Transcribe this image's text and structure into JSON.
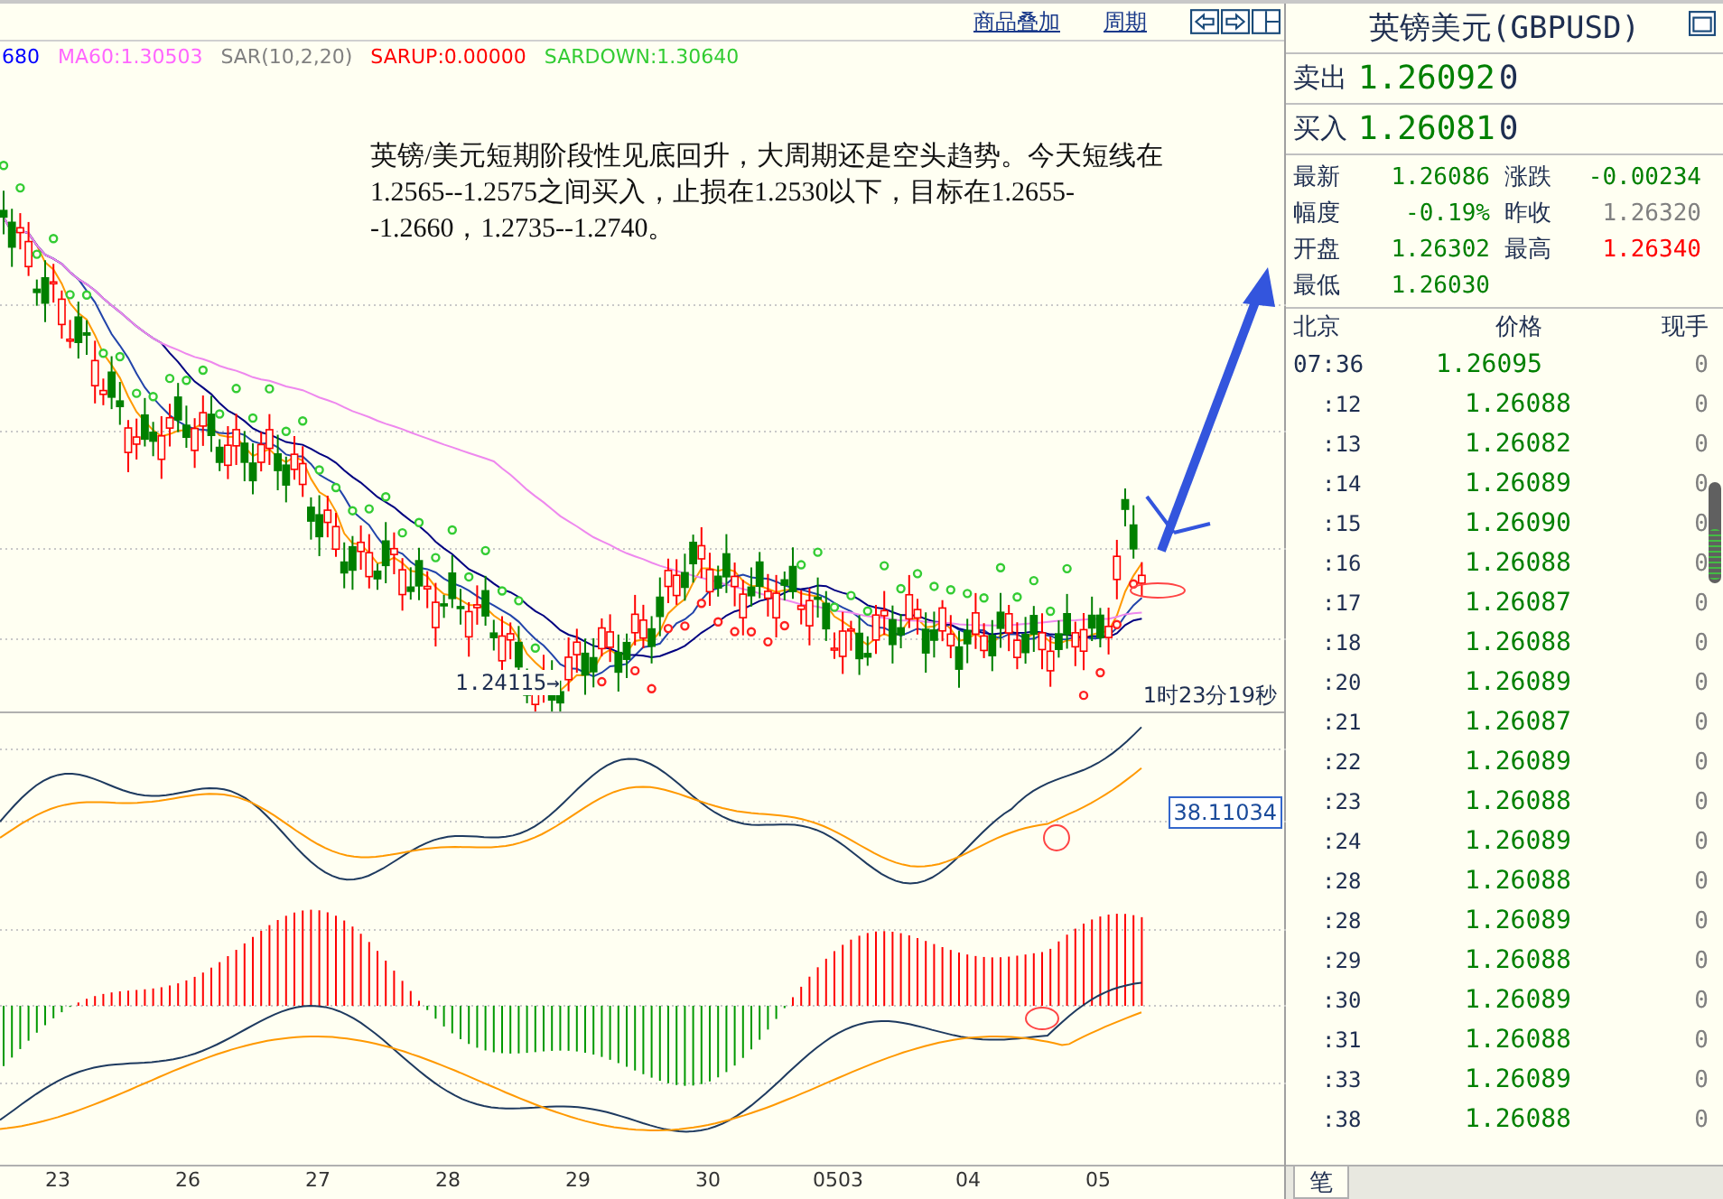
{
  "toolbar": {
    "links": [
      "商品叠加",
      "周期"
    ]
  },
  "legend": [
    {
      "text": "680",
      "color": "#0000ff"
    },
    {
      "text": "MA60:1.30503",
      "color": "#ff66ff"
    },
    {
      "text": "SAR(10,2,20)",
      "color": "#808080"
    },
    {
      "text": "SARUP:0.00000",
      "color": "#ff0000"
    },
    {
      "text": "SARDOWN:1.30640",
      "color": "#33cc33"
    }
  ],
  "annotation": "英镑/美元短期阶段性见底回升，大周期还是空头趋势。今天短线在1.2565--1.2575之间买入，止损在1.2530以下，目标在1.2655--1.2660，1.2735--1.2740。",
  "low_label": "1.24115→",
  "countdown": "1时23分19秒",
  "indicator_value": "38.11034",
  "x_axis": [
    "23",
    "26",
    "27",
    "28",
    "29",
    "30",
    "0503",
    "04",
    "05"
  ],
  "quote": {
    "title": "英镑美元(GBPUSD)",
    "sell": {
      "label": "卖出",
      "price": "1.26092",
      "volume": "0"
    },
    "buy": {
      "label": "买入",
      "price": "1.26081",
      "volume": "0"
    },
    "stats": [
      {
        "label": "最新",
        "value": "1.26086",
        "color": "#008000"
      },
      {
        "label": "涨跌",
        "value": "-0.00234",
        "color": "#008000"
      },
      {
        "label": "幅度",
        "value": "-0.19%",
        "color": "#008000"
      },
      {
        "label": "昨收",
        "value": "1.26320",
        "color": "#808080"
      },
      {
        "label": "开盘",
        "value": "1.26302",
        "color": "#008000"
      },
      {
        "label": "最高",
        "value": "1.26340",
        "color": "#ff0000"
      },
      {
        "label": "最低",
        "value": "1.26030",
        "color": "#008000"
      }
    ],
    "columns": [
      "北京",
      "价格",
      "现手"
    ],
    "ticks": [
      {
        "time": "07:36",
        "price": "1.26095",
        "volume": "0"
      },
      {
        "time": ":12",
        "price": "1.26088",
        "volume": "0"
      },
      {
        "time": ":13",
        "price": "1.26082",
        "volume": "0"
      },
      {
        "time": ":14",
        "price": "1.26089",
        "volume": "0"
      },
      {
        "time": ":15",
        "price": "1.26090",
        "volume": "0"
      },
      {
        "time": ":16",
        "price": "1.26088",
        "volume": "0"
      },
      {
        "time": ":17",
        "price": "1.26087",
        "volume": "0"
      },
      {
        "time": ":18",
        "price": "1.26088",
        "volume": "0"
      },
      {
        "time": ":20",
        "price": "1.26089",
        "volume": "0"
      },
      {
        "time": ":21",
        "price": "1.26087",
        "volume": "0"
      },
      {
        "time": ":22",
        "price": "1.26089",
        "volume": "0"
      },
      {
        "time": ":23",
        "price": "1.26088",
        "volume": "0"
      },
      {
        "time": ":24",
        "price": "1.26089",
        "volume": "0"
      },
      {
        "time": ":28",
        "price": "1.26088",
        "volume": "0"
      },
      {
        "time": ":28",
        "price": "1.26089",
        "volume": "0"
      },
      {
        "time": ":29",
        "price": "1.26088",
        "volume": "0"
      },
      {
        "time": ":30",
        "price": "1.26089",
        "volume": "0"
      },
      {
        "time": ":31",
        "price": "1.26088",
        "volume": "0"
      },
      {
        "time": ":33",
        "price": "1.26089",
        "volume": "0"
      },
      {
        "time": ":38",
        "price": "1.26088",
        "volume": "0"
      }
    ],
    "tabs": [
      {
        "label": "笔",
        "selected": true
      }
    ]
  }
}
